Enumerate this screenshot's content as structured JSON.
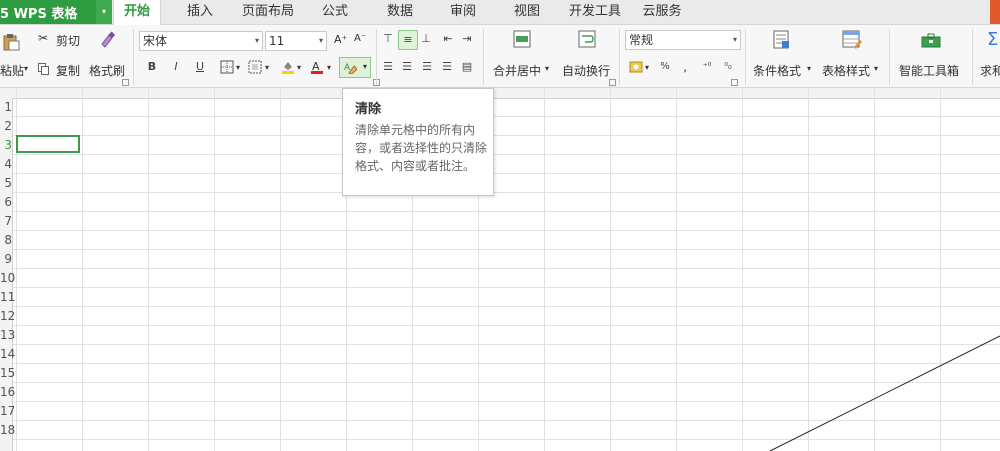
{
  "app_menu": {
    "label": "5  WPS 表格",
    "arrow": "▾"
  },
  "tabs": [
    {
      "label": "开始",
      "active": true
    },
    {
      "label": "插入"
    },
    {
      "label": "页面布局"
    },
    {
      "label": "公式"
    },
    {
      "label": "数据"
    },
    {
      "label": "审阅"
    },
    {
      "label": "视图"
    },
    {
      "label": "开发工具"
    },
    {
      "label": "云服务"
    }
  ],
  "ribbon": {
    "paste_label": "粘贴",
    "cut_label": "剪切",
    "copy_label": "复制",
    "format_painter_label": "格式刷",
    "font_name": "宋体",
    "font_size": "11",
    "grow_font": "A⁺",
    "shrink_font": "A⁻",
    "bold": "B",
    "italic": "I",
    "underline": "U",
    "merge_center_label": "合并居中",
    "wrap_text_label": "自动换行",
    "number_format": "常规",
    "percent": "%",
    "thousands": "‚",
    "inc_decimal": "⁺⁰",
    "dec_decimal": "⁰₀",
    "cond_format_label": "条件格式",
    "table_style_label": "表格样式",
    "smart_toolbox_label": "智能工具箱",
    "sum_label": "求和"
  },
  "tooltip": {
    "title": "清除",
    "description": "清除单元格中的所有内容，或者选择性的只清除格式、内容或者批注。"
  },
  "row_numbers": [
    "1",
    "2",
    "3",
    "4",
    "5",
    "6",
    "7",
    "8",
    "9",
    "10",
    "11",
    "12",
    "13",
    "14",
    "15",
    "16",
    "17",
    "18"
  ],
  "colors": {
    "accent": "#2e9c40",
    "active_cell_border": "#3e9a4a",
    "corner": "#e15a2e"
  }
}
